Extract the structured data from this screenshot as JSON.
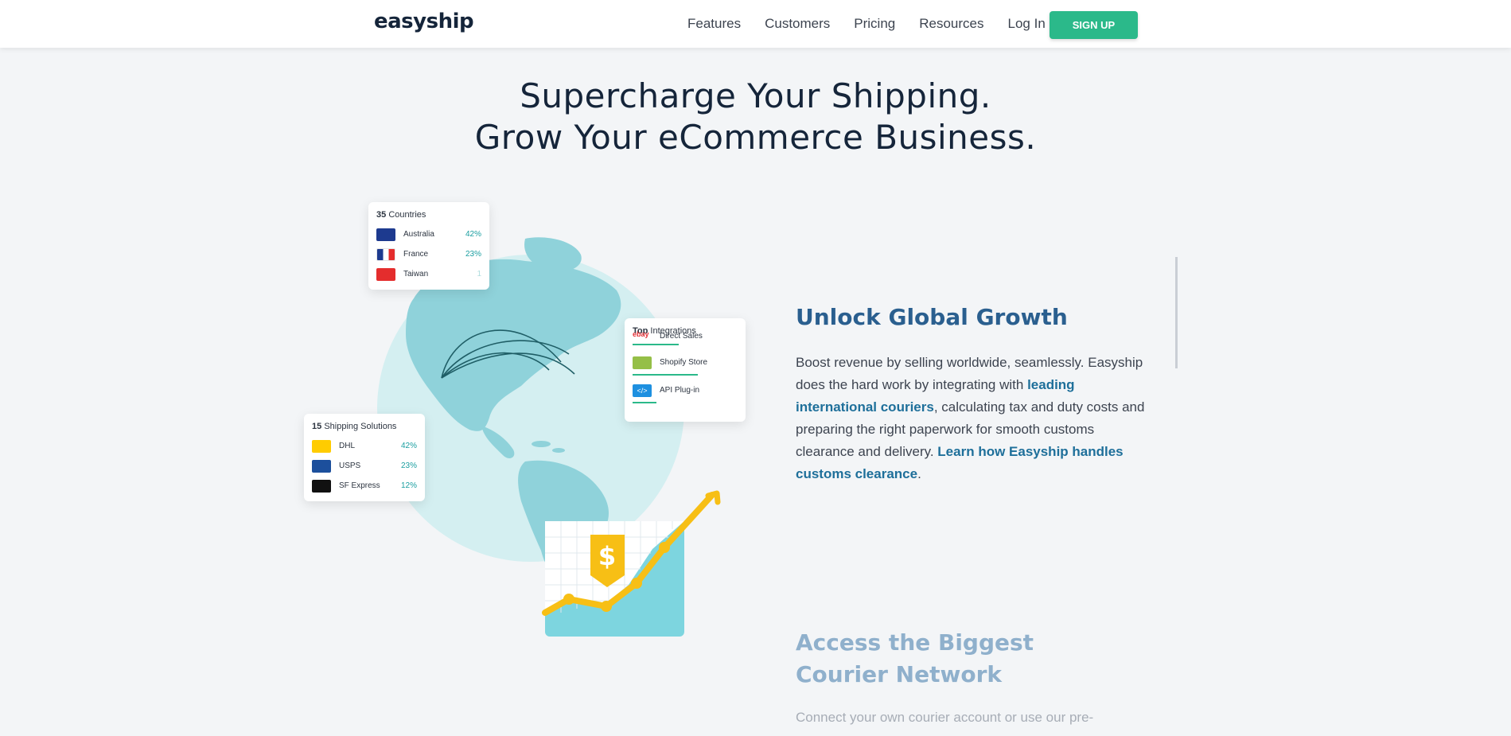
{
  "header": {
    "logo_text": "easyship",
    "nav": [
      "Features",
      "Customers",
      "Pricing",
      "Resources",
      "Log In"
    ],
    "signup_label": "SIGN UP"
  },
  "hero": {
    "title_line1": "Supercharge Your Shipping.",
    "title_line2": "Grow Your eCommerce Business."
  },
  "cards": {
    "countries": {
      "count": "35",
      "label": "Countries",
      "rows": [
        {
          "name": "Australia",
          "pct": "42%"
        },
        {
          "name": "France",
          "pct": "23%"
        },
        {
          "name": "Taiwan",
          "pct": "1"
        }
      ]
    },
    "integrations": {
      "prefix": "Top",
      "label": "Integrations",
      "rows": [
        {
          "icon_text": "ebay",
          "name": "Direct Sales"
        },
        {
          "name": "Shopify Store"
        },
        {
          "icon_text": "</>",
          "name": "API Plug-in"
        }
      ]
    },
    "solutions": {
      "count": "15",
      "label": "Shipping Solutions",
      "rows": [
        {
          "name": "DHL",
          "pct": "42%"
        },
        {
          "name": "USPS",
          "pct": "23%"
        },
        {
          "name": "SF Express",
          "pct": "12%"
        }
      ]
    }
  },
  "growth_badge": "$",
  "section1": {
    "heading": "Unlock Global Growth",
    "p1": "Boost revenue by selling worldwide, seamlessly. Easyship does the hard work by integrating with ",
    "link1": "leading international couriers",
    "p2": ", calculating tax and duty costs and preparing the right paperwork for smooth customs clearance and delivery. ",
    "link2": "Learn how Easyship handles customs clearance",
    "p3": "."
  },
  "section2": {
    "heading": "Access the Biggest Courier Network",
    "paragraph": "Connect your own courier account or use our pre-"
  },
  "colors": {
    "brand_green": "#2bb98a",
    "heading_blue": "#2a5f8f",
    "link_blue": "#1e6f9a",
    "globe_light": "#d4eff1",
    "globe_land": "#8fd2da",
    "chart_yellow": "#f7bf15",
    "chart_teal": "#7dd5df"
  }
}
